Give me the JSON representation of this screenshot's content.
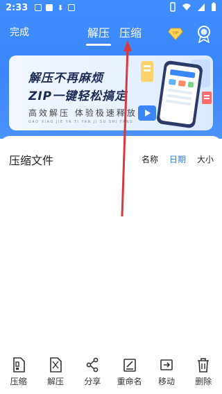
{
  "status_bar": {
    "time": "2:33",
    "left_icons": [
      "image-icon",
      "notification-icon",
      "download-icon",
      "text-icon"
    ],
    "right_icons": [
      "vibrate-icon",
      "wifi-icon",
      "signal-icon",
      "battery-icon"
    ]
  },
  "header": {
    "done_label": "完成",
    "tabs": [
      {
        "label": "解压",
        "active": true
      },
      {
        "label": "压缩",
        "active": false
      }
    ],
    "vip_icon": "vip-diamond-icon",
    "badge_icon": "medal-icon"
  },
  "banner": {
    "title_line1": "解压不再麻烦",
    "title_line2": "ZIP一键轻松搞定",
    "subtitle": "高效解压  体验极速释放",
    "pinyin": "GAO XIAO JIE YA   TI YAN JI SU SHI FANG"
  },
  "file_section": {
    "title": "压缩文件",
    "sort_options": [
      {
        "label": "名称",
        "active": false
      },
      {
        "label": "日期",
        "active": true
      },
      {
        "label": "大小",
        "active": false
      }
    ]
  },
  "toolbar": {
    "items": [
      {
        "label": "压缩",
        "icon": "compress-file-icon"
      },
      {
        "label": "解压",
        "icon": "extract-file-icon"
      },
      {
        "label": "分享",
        "icon": "share-icon"
      },
      {
        "label": "重命名",
        "icon": "rename-icon"
      },
      {
        "label": "移动",
        "icon": "move-icon"
      },
      {
        "label": "删除",
        "icon": "trash-icon"
      }
    ]
  },
  "colors": {
    "header_blue": "#3a86f8",
    "accent_blue": "#2f7cf6",
    "annotation_arrow": "#d9383a"
  }
}
